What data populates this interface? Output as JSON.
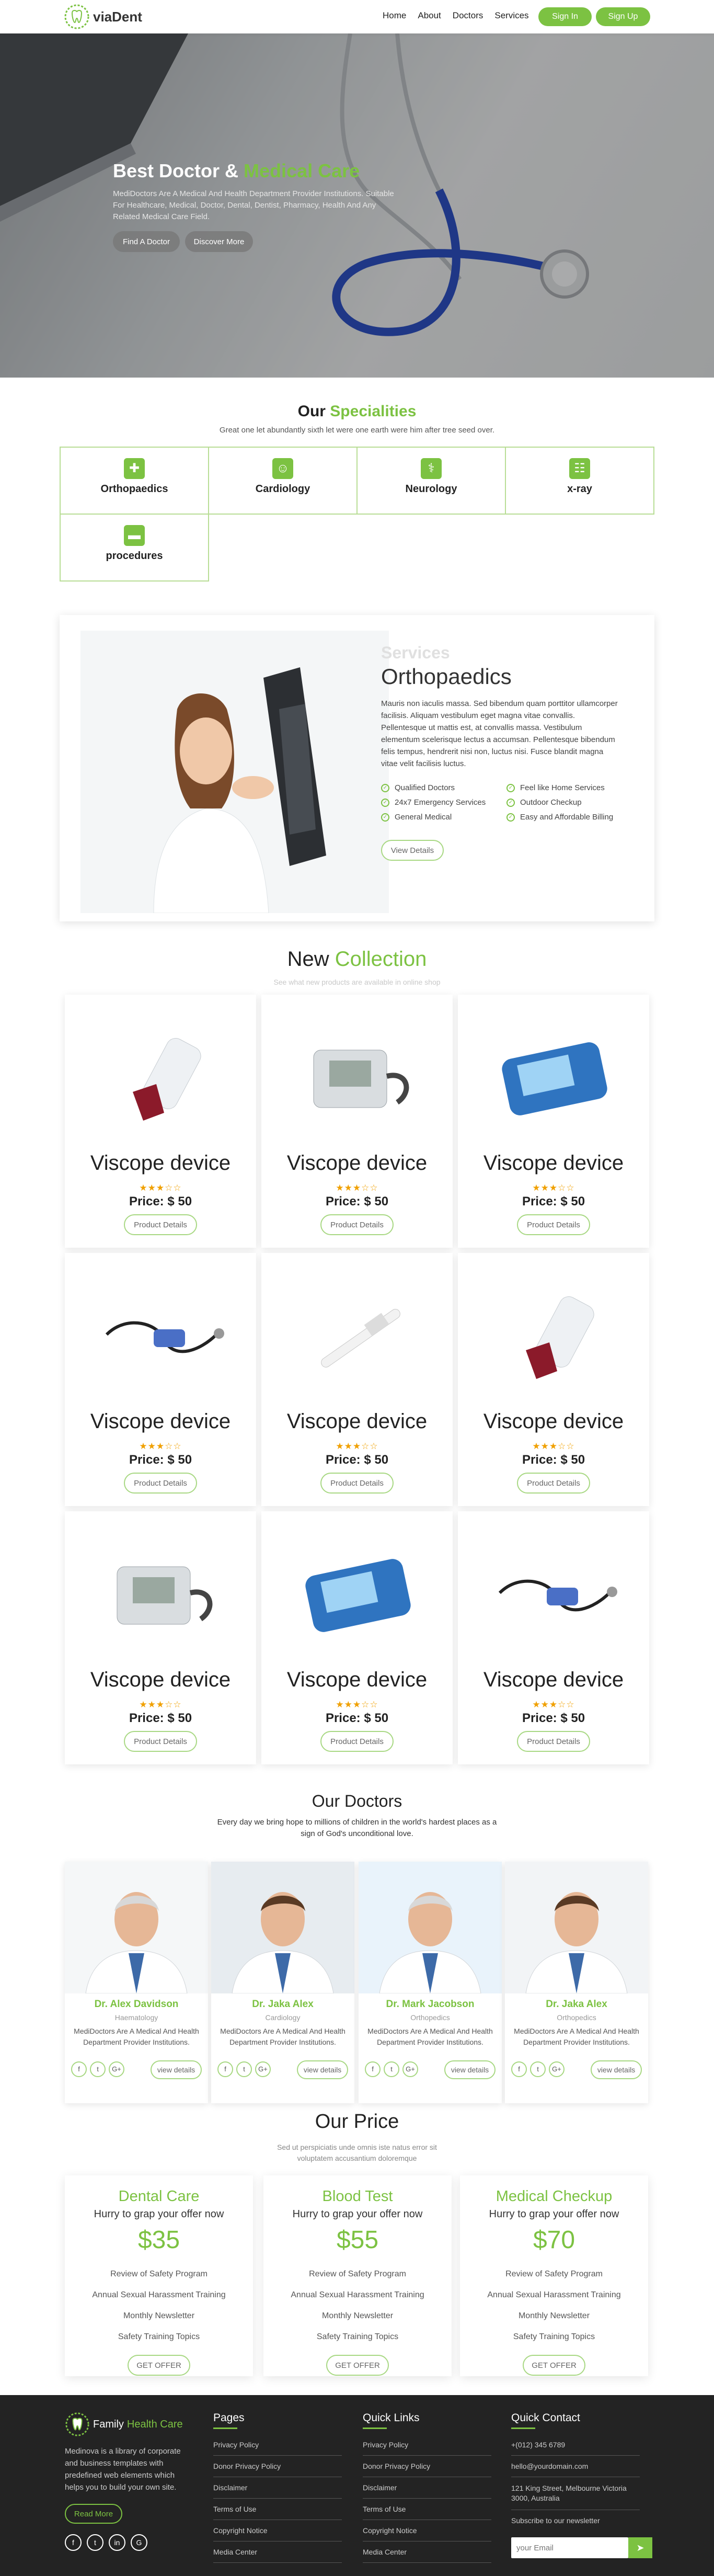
{
  "header": {
    "logo": "viaDent",
    "nav": [
      "Home",
      "About",
      "Doctors",
      "Services"
    ],
    "signin": "Sign In",
    "signup": "Sign Up"
  },
  "hero": {
    "title_white": "Best Doctor &",
    "title_green": "Medical Care",
    "text": "MediDoctors Are A Medical And Health Department Provider Institutions. Suitable For Healthcare, Medical, Doctor, Dental, Dentist, Pharmacy, Health And Any Related Medical Care Field.",
    "find": "Find A Doctor",
    "discover": "Discover More"
  },
  "specialities": {
    "title_dark": "Our",
    "title_green": "Specialities",
    "subtitle": "Great one let abundantly sixth let were one earth were him after tree seed over.",
    "items": [
      {
        "label": "Orthopaedics",
        "icon": "medical-kit-icon"
      },
      {
        "label": "Cardiology",
        "icon": "doctor-icon"
      },
      {
        "label": "Neurology",
        "icon": "stethoscope-icon"
      },
      {
        "label": "x-ray",
        "icon": "xray-icon"
      },
      {
        "label": "procedures",
        "icon": "hospital-bed-icon"
      }
    ]
  },
  "services": {
    "kicker": "Services",
    "title": "Orthopaedics",
    "text": "Mauris non iaculis massa. Sed bibendum quam porttitor ullamcorper facilisis. Aliquam vestibulum eget magna vitae convallis. Pellentesque ut mattis est, at convallis massa. Vestibulum elementum scelerisque lectus a accumsan. Pellentesque bibendum felis tempus, hendrerit nisi non, luctus nisi. Fusce blandit magna vitae velit facilisis luctus.",
    "features": [
      "Qualified Doctors",
      "Feel like Home Services",
      "24x7 Emergency Services",
      "Outdoor Checkup",
      "General Medical",
      "Easy and Affordable Billing"
    ],
    "button": "View Details"
  },
  "collection": {
    "title_dark": "New",
    "title_green": "Collection",
    "subtitle": "See what new products are available in online shop",
    "products": [
      {
        "name": "Viscope device",
        "price": "Price: $ 50",
        "rating": 2.5,
        "button": "Product Details",
        "kind": "inhaler"
      },
      {
        "name": "Viscope device",
        "price": "Price: $ 50",
        "rating": 2.5,
        "button": "Product Details",
        "kind": "bp-monitor"
      },
      {
        "name": "Viscope device",
        "price": "Price: $ 50",
        "rating": 2.5,
        "button": "Product Details",
        "kind": "glucometer"
      },
      {
        "name": "Viscope device",
        "price": "Price: $ 50",
        "rating": 2.5,
        "button": "Product Details",
        "kind": "stethoscope"
      },
      {
        "name": "Viscope device",
        "price": "Price: $ 50",
        "rating": 2.5,
        "button": "Product Details",
        "kind": "thermometer"
      },
      {
        "name": "Viscope device",
        "price": "Price: $ 50",
        "rating": 2.5,
        "button": "Product Details",
        "kind": "inhaler"
      },
      {
        "name": "Viscope device",
        "price": "Price: $ 50",
        "rating": 2.5,
        "button": "Product Details",
        "kind": "bp-monitor"
      },
      {
        "name": "Viscope device",
        "price": "Price: $ 50",
        "rating": 2.5,
        "button": "Product Details",
        "kind": "glucometer"
      },
      {
        "name": "Viscope device",
        "price": "Price: $ 50",
        "rating": 2.5,
        "button": "Product Details",
        "kind": "stethoscope"
      }
    ]
  },
  "doctors": {
    "title": "Our Doctors",
    "subtitle": "Every day we bring hope to millions of children in the world's hardest places as a sign of God's unconditional love.",
    "items": [
      {
        "name": "Dr. Alex Davidson",
        "role": "Haematology",
        "desc": "MediDoctors Are A Medical And Health Department Provider Institutions.",
        "button": "view details"
      },
      {
        "name": "Dr. Jaka Alex",
        "role": "Cardiology",
        "desc": "MediDoctors Are A Medical And Health Department Provider Institutions.",
        "button": "view details"
      },
      {
        "name": "Dr. Mark Jacobson",
        "role": "Orthopedics",
        "desc": "MediDoctors Are A Medical And Health Department Provider Institutions.",
        "button": "view details"
      },
      {
        "name": "Dr. Jaka Alex",
        "role": "Orthopedics",
        "desc": "MediDoctors Are A Medical And Health Department Provider Institutions.",
        "button": "view details"
      }
    ]
  },
  "pricing": {
    "title": "Our Price",
    "subtitle": "Sed ut perspiciatis unde omnis iste natus error sit voluptatem accusantium doloremque",
    "plans": [
      {
        "name": "Dental Care",
        "hook": "Hurry to grap your offer now",
        "price": "$35",
        "features": [
          "Review of Safety Program",
          "Annual Sexual Harassment Training",
          "Monthly Newsletter",
          "Safety Training Topics"
        ],
        "button": "GET OFFER"
      },
      {
        "name": "Blood Test",
        "hook": "Hurry to grap your offer now",
        "price": "$55",
        "features": [
          "Review of Safety Program",
          "Annual Sexual Harassment Training",
          "Monthly Newsletter",
          "Safety Training Topics"
        ],
        "button": "GET OFFER"
      },
      {
        "name": "Medical Checkup",
        "hook": "Hurry to grap your offer now",
        "price": "$70",
        "features": [
          "Review of Safety Program",
          "Annual Sexual Harassment Training",
          "Monthly Newsletter",
          "Safety Training Topics"
        ],
        "button": "GET OFFER"
      }
    ]
  },
  "footer": {
    "brand_a": "Family",
    "brand_b": "Health Care",
    "desc": "Medinova is a library of corporate and business templates with predefined web elements which helps you to build your own site.",
    "read_more": "Read More",
    "social": [
      "f",
      "t",
      "in",
      "G"
    ],
    "pages_title": "Pages",
    "pages": [
      "Privacy Policy",
      "Donor Privacy Policy",
      "Disclaimer",
      "Terms of Use",
      "Copyright Notice",
      "Media Center"
    ],
    "links_title": "Quick Links",
    "links": [
      "Privacy Policy",
      "Donor Privacy Policy",
      "Disclaimer",
      "Terms of Use",
      "Copyright Notice",
      "Media Center"
    ],
    "contact_title": "Quick Contact",
    "contact": [
      "+(012) 345 6789",
      "hello@yourdomain.com",
      "121 King Street, Melbourne Victoria 3000, Australia",
      "Subscribe to our newsletter"
    ],
    "email_placeholder": "your Email"
  },
  "colors": {
    "accent": "#7cc242",
    "footer_bg": "#232323",
    "star": "#f0a000"
  }
}
